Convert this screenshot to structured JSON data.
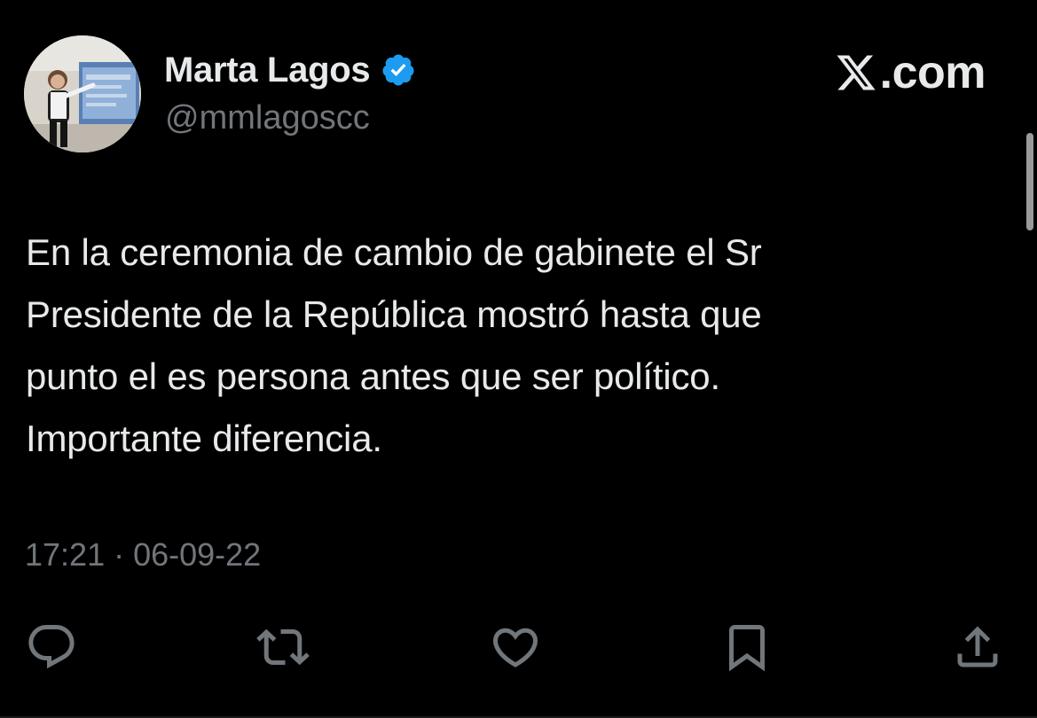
{
  "author": {
    "display_name": "Marta Lagos",
    "handle": "@mmlagoscc",
    "verified": true,
    "verified_badge_icon": "verified-badge-icon",
    "verified_color": "#1d9bf0"
  },
  "brand": {
    "text": ".com",
    "icon": "x-logo-icon"
  },
  "tweet": {
    "text": "En la ceremonia de cambio de gabinete el Sr\nPresidente de la República mostró hasta que\npunto el es persona antes que ser político.\nImportante diferencia.",
    "timestamp": "17:21 · 06-09-22"
  },
  "actions": [
    {
      "name": "reply",
      "icon": "speech-bubble-icon"
    },
    {
      "name": "retweet",
      "icon": "retweet-arrows-icon"
    },
    {
      "name": "like",
      "icon": "heart-icon"
    },
    {
      "name": "bookmark",
      "icon": "bookmark-icon"
    },
    {
      "name": "share",
      "icon": "share-upload-icon"
    }
  ],
  "colors": {
    "background": "#000000",
    "primary_text": "#e7e9ea",
    "secondary_text": "#71767b",
    "icon": "#71767b"
  }
}
